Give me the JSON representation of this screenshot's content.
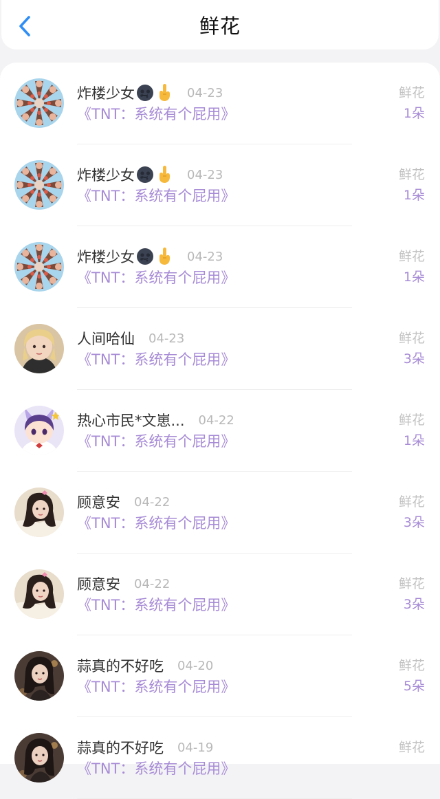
{
  "header": {
    "title": "鲜花",
    "back_icon": "chevron-left-icon",
    "accent_color": "#2f8ef5"
  },
  "records": [
    {
      "name": "炸楼少女",
      "emojis": [
        "new-moon-face-icon",
        "middle-finger-icon"
      ],
      "date": "04-23",
      "topic": "《TNT：系统有个屁用》",
      "gift": "鲜花",
      "count": "1朵",
      "avatar": "pattern"
    },
    {
      "name": "炸楼少女",
      "emojis": [
        "new-moon-face-icon",
        "middle-finger-icon"
      ],
      "date": "04-23",
      "topic": "《TNT：系统有个屁用》",
      "gift": "鲜花",
      "count": "1朵",
      "avatar": "pattern"
    },
    {
      "name": "炸楼少女",
      "emojis": [
        "new-moon-face-icon",
        "middle-finger-icon"
      ],
      "date": "04-23",
      "topic": "《TNT：系统有个屁用》",
      "gift": "鲜花",
      "count": "1朵",
      "avatar": "pattern"
    },
    {
      "name": "人间哈仙",
      "emojis": [],
      "date": "04-23",
      "topic": "《TNT：系统有个屁用》",
      "gift": "鲜花",
      "count": "3朵",
      "avatar": "blonde"
    },
    {
      "name": "热心市民*文崽...",
      "emojis": [],
      "date": "04-22",
      "topic": "《TNT：系统有个屁用》",
      "gift": "鲜花",
      "count": "1朵",
      "avatar": "anime"
    },
    {
      "name": "顾意安",
      "emojis": [],
      "date": "04-22",
      "topic": "《TNT：系统有个屁用》",
      "gift": "鲜花",
      "count": "3朵",
      "avatar": "photo-light"
    },
    {
      "name": "顾意安",
      "emojis": [],
      "date": "04-22",
      "topic": "《TNT：系统有个屁用》",
      "gift": "鲜花",
      "count": "3朵",
      "avatar": "photo-light"
    },
    {
      "name": "蒜真的不好吃",
      "emojis": [],
      "date": "04-20",
      "topic": "《TNT：系统有个屁用》",
      "gift": "鲜花",
      "count": "5朵",
      "avatar": "photo-dark"
    },
    {
      "name": "蒜真的不好吃",
      "emojis": [],
      "date": "04-19",
      "topic": "《TNT：系统有个屁用》",
      "gift": "鲜花",
      "count": "",
      "avatar": "photo-dark"
    }
  ]
}
